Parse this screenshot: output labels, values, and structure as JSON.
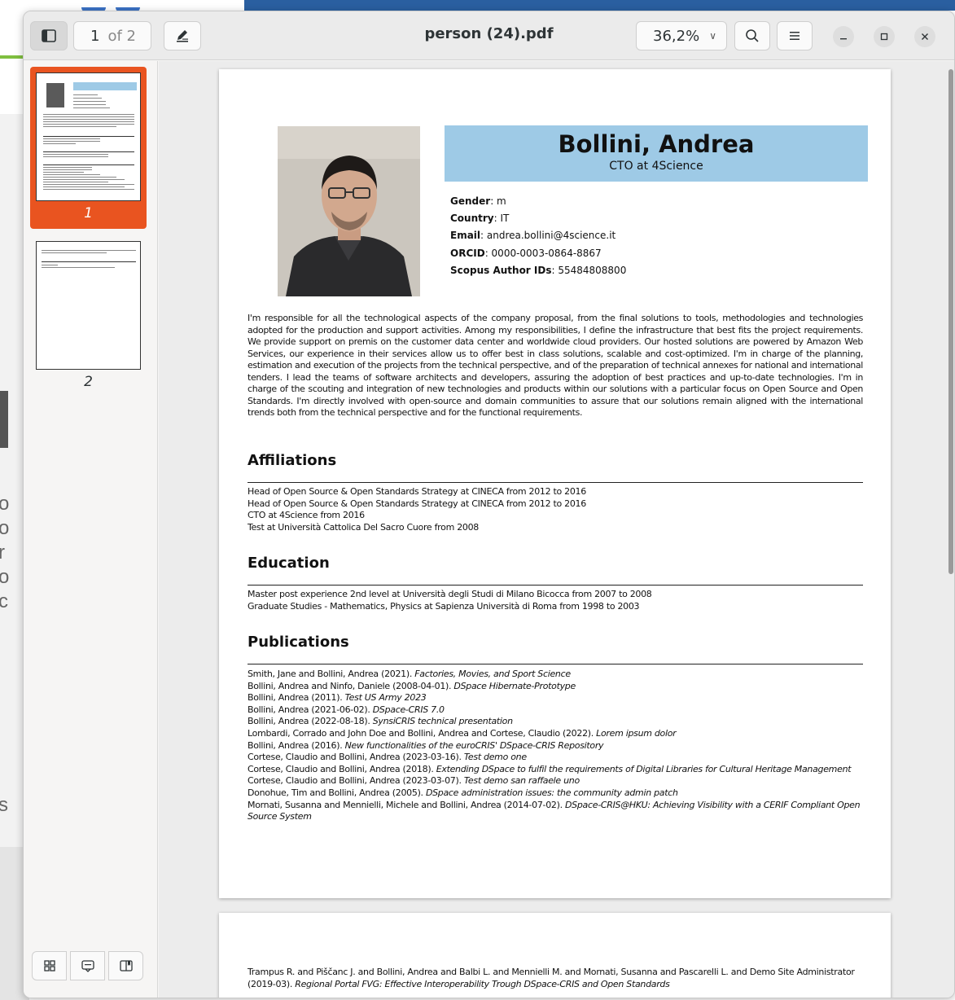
{
  "window": {
    "title": "person (24).pdf",
    "page_current": "1",
    "page_total": "of 2",
    "zoom": "36,2%"
  },
  "icons": {
    "sidebar_toggle": "sidebar-icon",
    "annotate": "pen-annotate-icon",
    "search": "search-icon",
    "menu": "hamburger-menu-icon",
    "minimize": "minimize-icon",
    "maximize": "maximize-icon",
    "close": "close-icon",
    "thumbnails": "grid-icon",
    "annotations": "annotations-icon",
    "bookmarks": "bookmarks-icon"
  },
  "colors": {
    "accent": "#e95420",
    "name_box": "#9ecae6"
  },
  "sidebar": {
    "thumbnails": [
      {
        "number": "1",
        "selected": true
      },
      {
        "number": "2",
        "selected": false
      }
    ]
  },
  "document": {
    "name": "Bollini, Andrea",
    "role": "CTO at 4Science",
    "details": [
      {
        "label": "Gender",
        "value": ": m"
      },
      {
        "label": "Country",
        "value": ": IT"
      },
      {
        "label": "Email",
        "value": ": andrea.bollini@4science.it"
      },
      {
        "label": "ORCID",
        "value": ": 0000-0003-0864-8867"
      },
      {
        "label": "Scopus Author IDs",
        "value": ": 55484808800"
      }
    ],
    "bio": "I'm responsible for all the technological aspects of the company proposal, from the final solutions to tools, methodologies and technologies adopted for the production and support activities. Among my responsibilities, I define the infrastructure that best fits the project requirements. We provide support on premis on the customer data center and worldwide cloud providers. Our hosted solutions are powered by Amazon Web Services, our experience in their services allow us to offer best in class solutions, scalable and cost-optimized. I'm in charge of the planning, estimation and execution of the projects from the technical perspective, and of the preparation of technical annexes for national and international tenders. I lead the teams of software architects and developers, assuring the adoption of best practices and up-to-date technologies. I'm in charge of the scouting and integration of new technologies and products within our solutions with a particular focus on Open Source and Open Standards. I'm directly involved with open-source and domain communities to assure that our solutions remain aligned with the international trends both from the technical perspective and for the functional requirements.",
    "affiliations_title": "Affiliations",
    "affiliations": [
      "Head of Open Source & Open Standards Strategy at CINECA from 2012 to 2016",
      "Head of Open Source & Open Standards Strategy at CINECA from 2012 to 2016",
      "CTO at 4Science from 2016",
      "Test at Università Cattolica Del Sacro Cuore from 2008"
    ],
    "education_title": "Education",
    "education": [
      "Master post experience 2nd level at Università degli Studi di Milano Bicocca from 2007 to 2008",
      "Graduate Studies - Mathematics, Physics at Sapienza Università di Roma from 1998 to 2003"
    ],
    "publications_title": "Publications",
    "publications": [
      {
        "authors": "Smith, Jane and Bollini, Andrea (2021). ",
        "title": "Factories, Movies, and Sport Science"
      },
      {
        "authors": "Bollini, Andrea and Ninfo, Daniele (2008-04-01). ",
        "title": "DSpace Hibernate-Prototype"
      },
      {
        "authors": "Bollini, Andrea (2011). ",
        "title": "Test US Army 2023"
      },
      {
        "authors": "Bollini, Andrea (2021-06-02). ",
        "title": "DSpace-CRIS 7.0"
      },
      {
        "authors": "Bollini, Andrea (2022-08-18). ",
        "title": "SynsiCRIS technical presentation"
      },
      {
        "authors": "Lombardi, Corrado and John Doe and Bollini, Andrea and Cortese, Claudio (2022). ",
        "title": "Lorem ipsum dolor"
      },
      {
        "authors": "Bollini, Andrea (2016). ",
        "title": "New functionalities of the euroCRIS' DSpace-CRIS Repository"
      },
      {
        "authors": "Cortese, Claudio and Bollini, Andrea (2023-03-16). ",
        "title": "Test demo one"
      },
      {
        "authors": "Cortese, Claudio and Bollini, Andrea (2018). ",
        "title": "Extending DSpace to fulfil the requirements of Digital Libraries for Cultural Heritage Management"
      },
      {
        "authors": "Cortese, Claudio and Bollini, Andrea (2023-03-07). ",
        "title": "Test demo san raffaele uno"
      },
      {
        "authors": "Donohue, Tim and Bollini, Andrea (2005). ",
        "title": "DSpace administration issues: the community admin patch"
      },
      {
        "authors": "Mornati, Susanna and Mennielli, Michele and Bollini, Andrea (2014-07-02). ",
        "title": "DSpace-CRIS@HKU: Achieving Visibility with a CERIF Compliant Open Source System"
      }
    ],
    "page2_text": {
      "authors": "Trampus R. and Piščanc J. and Bollini, Andrea and Balbi L. and Mennielli M. and Mornati, Susanna and Pascarelli L. and Demo Site Administrator (2019-03). ",
      "title": "Regional Portal FVG: Effective Interoperability Trough DSpace-CRIS and Open Standards"
    }
  }
}
